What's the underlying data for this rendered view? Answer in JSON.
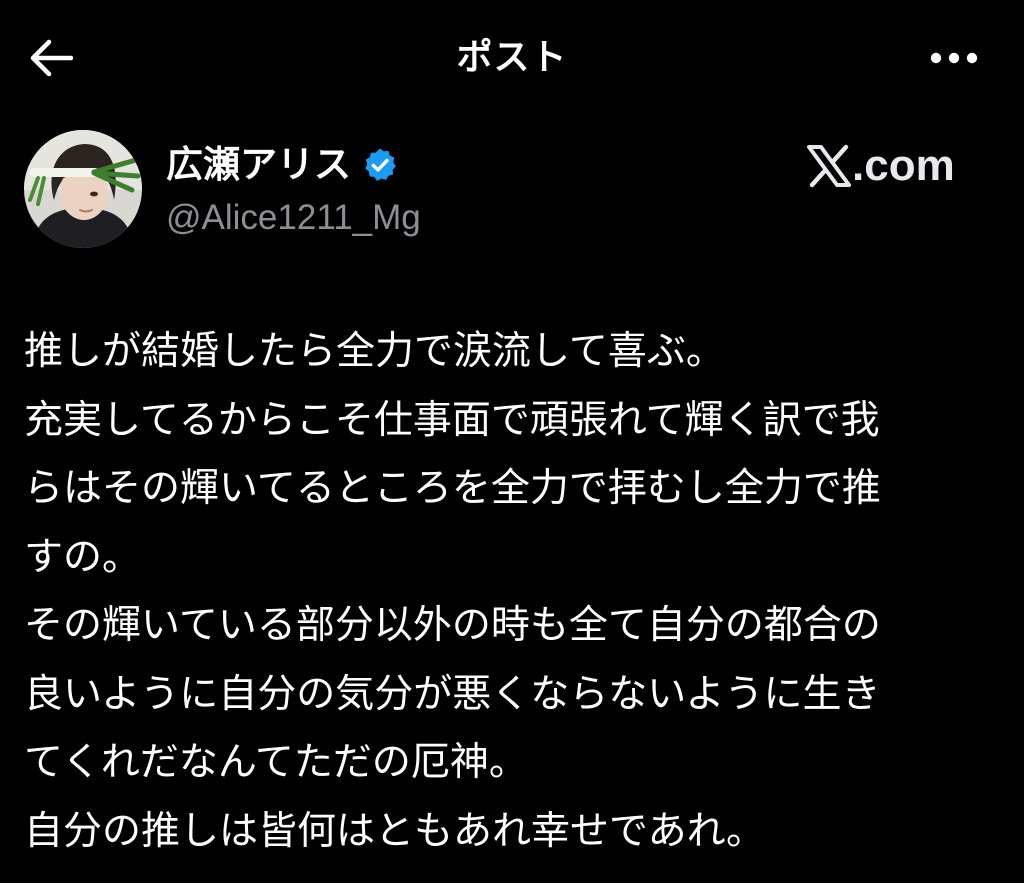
{
  "header": {
    "title": "ポスト",
    "back_icon": "arrow-left-icon",
    "more_icon": "more-horizontal-icon"
  },
  "author": {
    "name": "広瀬アリス",
    "handle": "@Alice1211_Mg",
    "verified": true,
    "verified_color": "#1d9bf0"
  },
  "watermark": {
    "x_mark": "𝕏",
    "domain": ".com"
  },
  "post": {
    "lines": [
      "推しが結婚したら全力で涙流して喜ぶ。",
      "充実してるからこそ仕事面で頑張れて輝く訳で我",
      "らはその輝いてるところを全力で拝むし全力で推",
      "すの。",
      "その輝いている部分以外の時も全て自分の都合の",
      "良いように自分の気分が悪くならないように生き",
      "てくれだなんてただの厄神。",
      "自分の推しは皆何はともあれ幸せであれ。"
    ]
  },
  "colors": {
    "background": "#000000",
    "text": "#ffffff",
    "secondary_text": "#8b8f95"
  }
}
